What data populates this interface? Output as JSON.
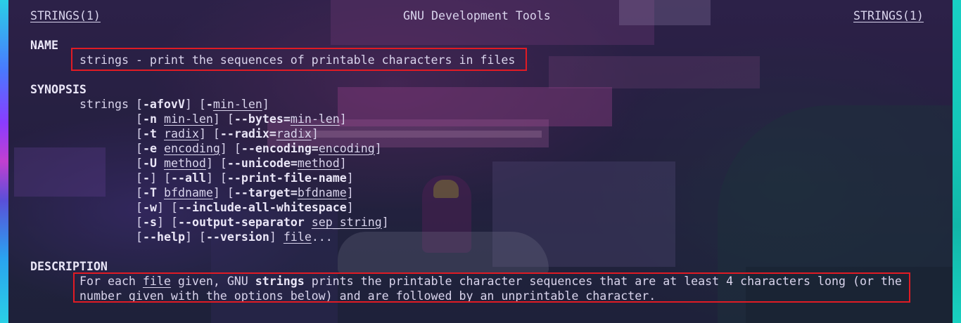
{
  "man_page": {
    "header": {
      "left": "STRINGS(1)",
      "center": "GNU Development Tools",
      "right": "STRINGS(1)"
    },
    "sections": {
      "name": {
        "heading": "NAME",
        "text": "strings - print the sequences of printable characters in files"
      },
      "synopsis": {
        "heading": "SYNOPSIS",
        "lines": [
          [
            {
              "t": "strings ",
              "s": ""
            },
            {
              "t": "[",
              "s": ""
            },
            {
              "t": "-afovV",
              "s": "b"
            },
            {
              "t": "] [",
              "s": ""
            },
            {
              "t": "-",
              "s": "b"
            },
            {
              "t": "min-len",
              "s": "u"
            },
            {
              "t": "]",
              "s": ""
            }
          ],
          [
            {
              "t": "[",
              "s": ""
            },
            {
              "t": "-n",
              "s": "b"
            },
            {
              "t": " ",
              "s": ""
            },
            {
              "t": "min-len",
              "s": "u"
            },
            {
              "t": "] [",
              "s": ""
            },
            {
              "t": "--bytes=",
              "s": "b"
            },
            {
              "t": "min-len",
              "s": "u"
            },
            {
              "t": "]",
              "s": ""
            }
          ],
          [
            {
              "t": "[",
              "s": ""
            },
            {
              "t": "-t",
              "s": "b"
            },
            {
              "t": " ",
              "s": ""
            },
            {
              "t": "radix",
              "s": "u"
            },
            {
              "t": "] [",
              "s": ""
            },
            {
              "t": "--radix=",
              "s": "b"
            },
            {
              "t": "radix",
              "s": "u"
            },
            {
              "t": "]",
              "s": ""
            }
          ],
          [
            {
              "t": "[",
              "s": ""
            },
            {
              "t": "-e",
              "s": "b"
            },
            {
              "t": " ",
              "s": ""
            },
            {
              "t": "encoding",
              "s": "u"
            },
            {
              "t": "] [",
              "s": ""
            },
            {
              "t": "--encoding=",
              "s": "b"
            },
            {
              "t": "encoding",
              "s": "u"
            },
            {
              "t": "]",
              "s": ""
            }
          ],
          [
            {
              "t": "[",
              "s": ""
            },
            {
              "t": "-U",
              "s": "b"
            },
            {
              "t": " ",
              "s": ""
            },
            {
              "t": "method",
              "s": "u"
            },
            {
              "t": "] [",
              "s": ""
            },
            {
              "t": "--unicode=",
              "s": "b"
            },
            {
              "t": "method",
              "s": "u"
            },
            {
              "t": "]",
              "s": ""
            }
          ],
          [
            {
              "t": "[",
              "s": ""
            },
            {
              "t": "-",
              "s": "b"
            },
            {
              "t": "] [",
              "s": ""
            },
            {
              "t": "--all",
              "s": "b"
            },
            {
              "t": "] [",
              "s": ""
            },
            {
              "t": "--print-file-name",
              "s": "b"
            },
            {
              "t": "]",
              "s": ""
            }
          ],
          [
            {
              "t": "[",
              "s": ""
            },
            {
              "t": "-T",
              "s": "b"
            },
            {
              "t": " ",
              "s": ""
            },
            {
              "t": "bfdname",
              "s": "u"
            },
            {
              "t": "] [",
              "s": ""
            },
            {
              "t": "--target=",
              "s": "b"
            },
            {
              "t": "bfdname",
              "s": "u"
            },
            {
              "t": "]",
              "s": ""
            }
          ],
          [
            {
              "t": "[",
              "s": ""
            },
            {
              "t": "-w",
              "s": "b"
            },
            {
              "t": "] [",
              "s": ""
            },
            {
              "t": "--include-all-whitespace",
              "s": "b"
            },
            {
              "t": "]",
              "s": ""
            }
          ],
          [
            {
              "t": "[",
              "s": ""
            },
            {
              "t": "-s",
              "s": "b"
            },
            {
              "t": "] [",
              "s": ""
            },
            {
              "t": "--output-separator",
              "s": "b"
            },
            {
              "t": " ",
              "s": ""
            },
            {
              "t": "sep_string",
              "s": "u"
            },
            {
              "t": "]",
              "s": ""
            }
          ],
          [
            {
              "t": "[",
              "s": ""
            },
            {
              "t": "--help",
              "s": "b"
            },
            {
              "t": "] [",
              "s": ""
            },
            {
              "t": "--version",
              "s": "b"
            },
            {
              "t": "] ",
              "s": ""
            },
            {
              "t": "file",
              "s": "u"
            },
            {
              "t": "...",
              "s": ""
            }
          ]
        ]
      },
      "description": {
        "heading": "DESCRIPTION",
        "lines": [
          [
            {
              "t": "For each ",
              "s": ""
            },
            {
              "t": "file",
              "s": "u"
            },
            {
              "t": " given, GNU ",
              "s": ""
            },
            {
              "t": "strings",
              "s": "b"
            },
            {
              "t": " prints the printable character sequences that are at least 4 characters long (or the",
              "s": ""
            }
          ],
          [
            {
              "t": "number given with the options below) and are followed by an unprintable character.",
              "s": ""
            }
          ]
        ]
      }
    }
  },
  "colors": {
    "highlight_border": "#e01b24",
    "text": "#d9d4ec",
    "bold_text": "#eae6f7"
  }
}
